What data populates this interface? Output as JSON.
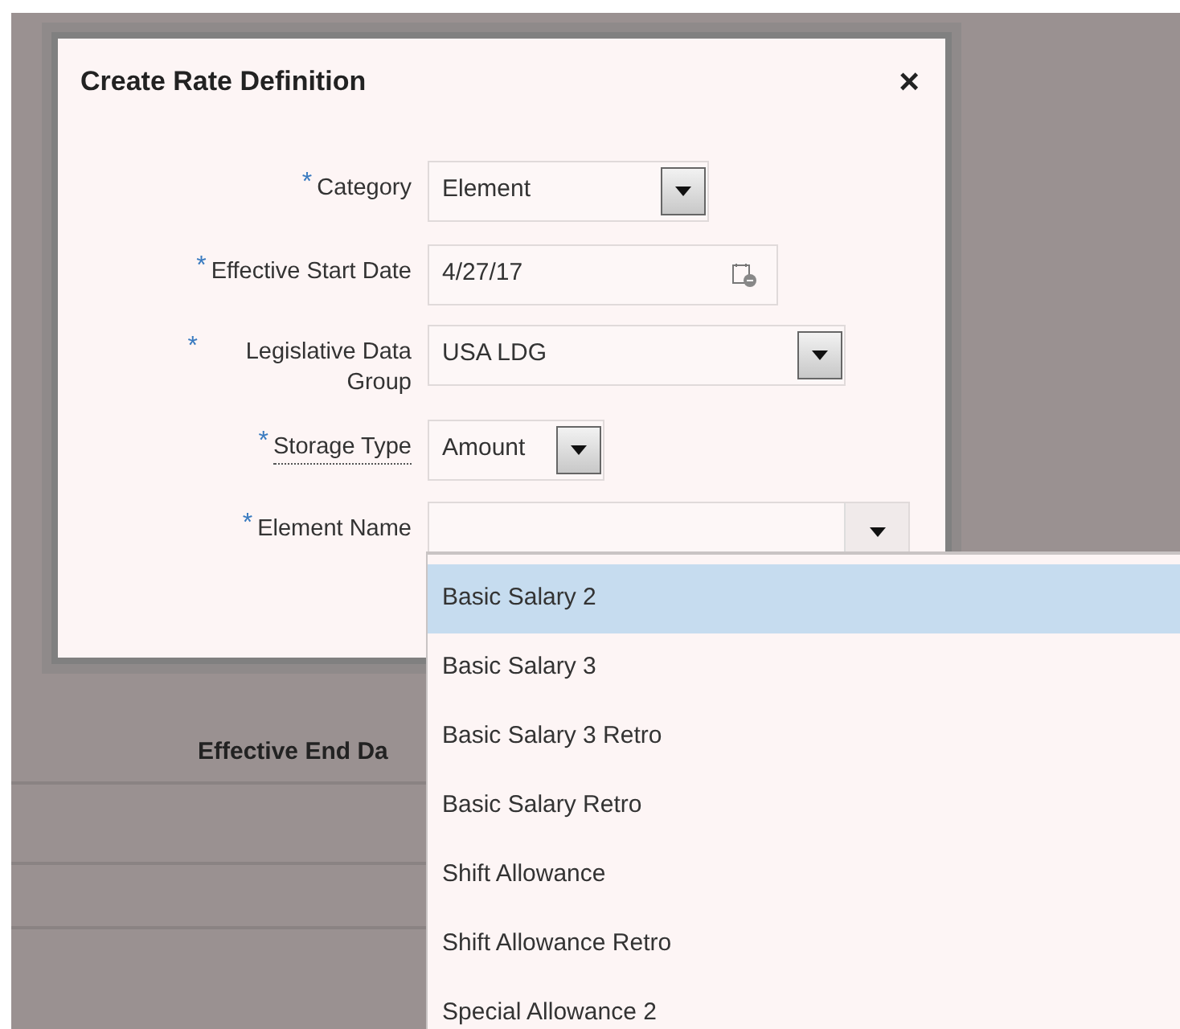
{
  "background": {
    "label": "Effective End Da"
  },
  "dialog": {
    "title": "Create Rate Definition",
    "close": "×",
    "fields": [
      {
        "required_mark": "*",
        "label": "Category",
        "help": false,
        "kind": "select",
        "value": "Element"
      },
      {
        "required_mark": "*",
        "label": "Effective Start Date",
        "help": false,
        "kind": "date",
        "value": "4/27/17"
      },
      {
        "required_mark": "*",
        "label": "Legislative Data Group",
        "help": false,
        "kind": "select",
        "value": "USA LDG"
      },
      {
        "required_mark": "*",
        "label": "Storage Type",
        "help": true,
        "kind": "select",
        "value": "Amount"
      },
      {
        "required_mark": "*",
        "label": "Element Name",
        "help": false,
        "kind": "combo"
      }
    ]
  },
  "list": {
    "items": [
      {
        "label": "Basic Salary 2",
        "selected": true
      },
      {
        "label": "Basic Salary 3",
        "selected": false
      },
      {
        "label": "Basic Salary 3 Retro",
        "selected": false
      },
      {
        "label": "Basic Salary Retro",
        "selected": false
      },
      {
        "label": "Shift Allowance",
        "selected": false
      },
      {
        "label": "Shift Allowance Retro",
        "selected": false
      },
      {
        "label": "Special Allowance 2",
        "selected": false
      }
    ]
  }
}
